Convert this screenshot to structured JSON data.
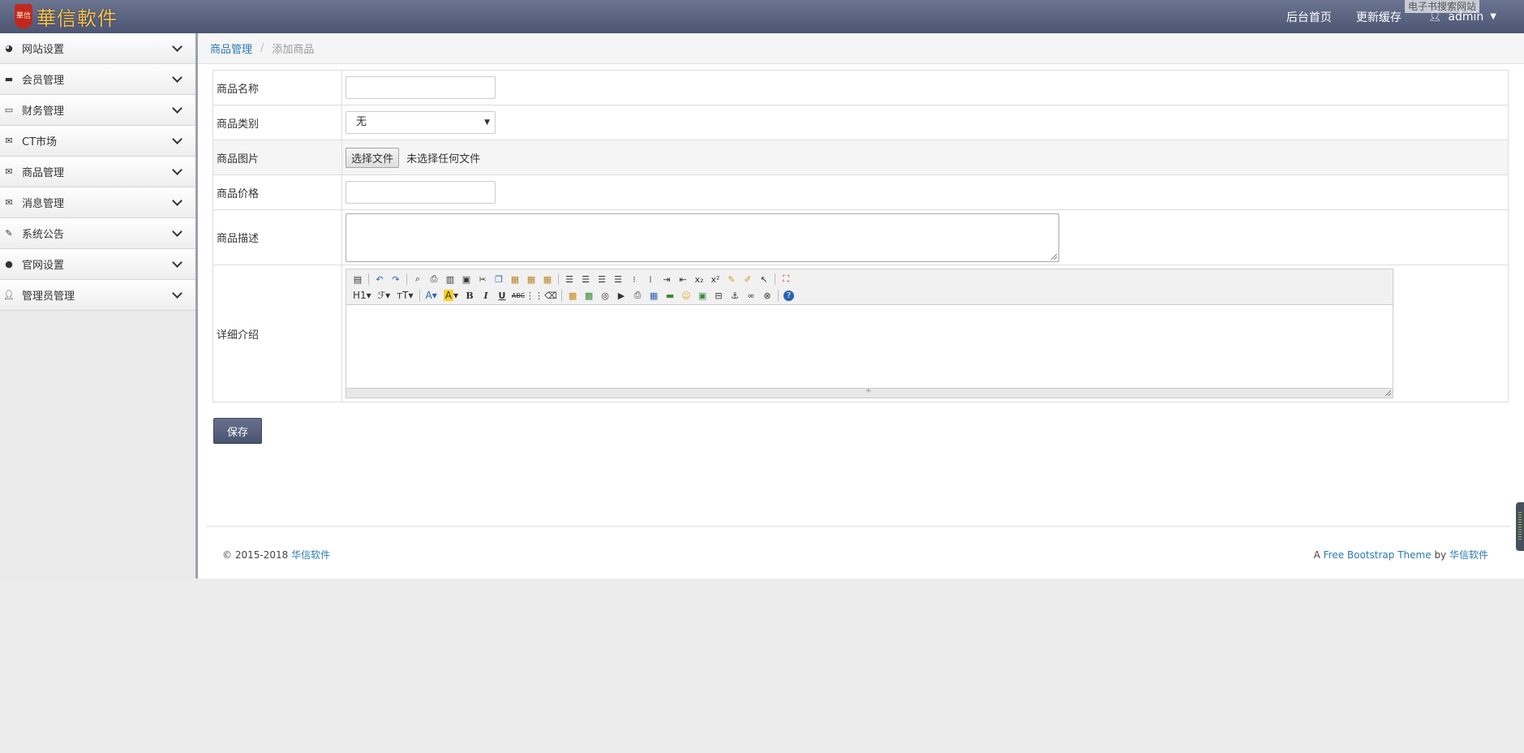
{
  "header": {
    "logo_seal": "華信",
    "logo_text": "華信軟件",
    "nav": [
      "后台首页",
      "更新缓存"
    ],
    "user": "admin",
    "watermark": "电子书搜索网站"
  },
  "sidebar": {
    "items": [
      {
        "label": "网站设置",
        "icon": "dashboard-icon"
      },
      {
        "label": "会员管理",
        "icon": "briefcase-icon"
      },
      {
        "label": "财务管理",
        "icon": "credit-card-icon"
      },
      {
        "label": "CT市场",
        "icon": "envelope-icon"
      },
      {
        "label": "商品管理",
        "icon": "envelope-icon"
      },
      {
        "label": "消息管理",
        "icon": "envelope-icon"
      },
      {
        "label": "系统公告",
        "icon": "edit-icon"
      },
      {
        "label": "官网设置",
        "icon": "comment-icon"
      },
      {
        "label": "管理员管理",
        "icon": "user-icon"
      }
    ]
  },
  "breadcrumb": {
    "parent": "商品管理",
    "separator": "/",
    "current": "添加商品"
  },
  "form": {
    "name_label": "商品名称",
    "name_value": "",
    "category_label": "商品类别",
    "category_value": "无",
    "image_label": "商品图片",
    "file_button": "选择文件",
    "file_status": "未选择任何文件",
    "price_label": "商品价格",
    "price_value": "",
    "desc_label": "商品描述",
    "detail_label": "详细介绍"
  },
  "editor": {
    "heading_btn": "H1",
    "font_btn": "ℱ",
    "size_btn": "тT"
  },
  "save_button": "保存",
  "footer": {
    "copyright": "© 2015-2018",
    "company": "华信软件",
    "theme_prefix": "A",
    "theme_link": "Free Bootstrap Theme",
    "theme_by": "by",
    "theme_author": "华信软件"
  },
  "colors": {
    "topbar": "#5b6480",
    "accent_link": "#2a7ab5",
    "save_button": "#5a6380"
  }
}
